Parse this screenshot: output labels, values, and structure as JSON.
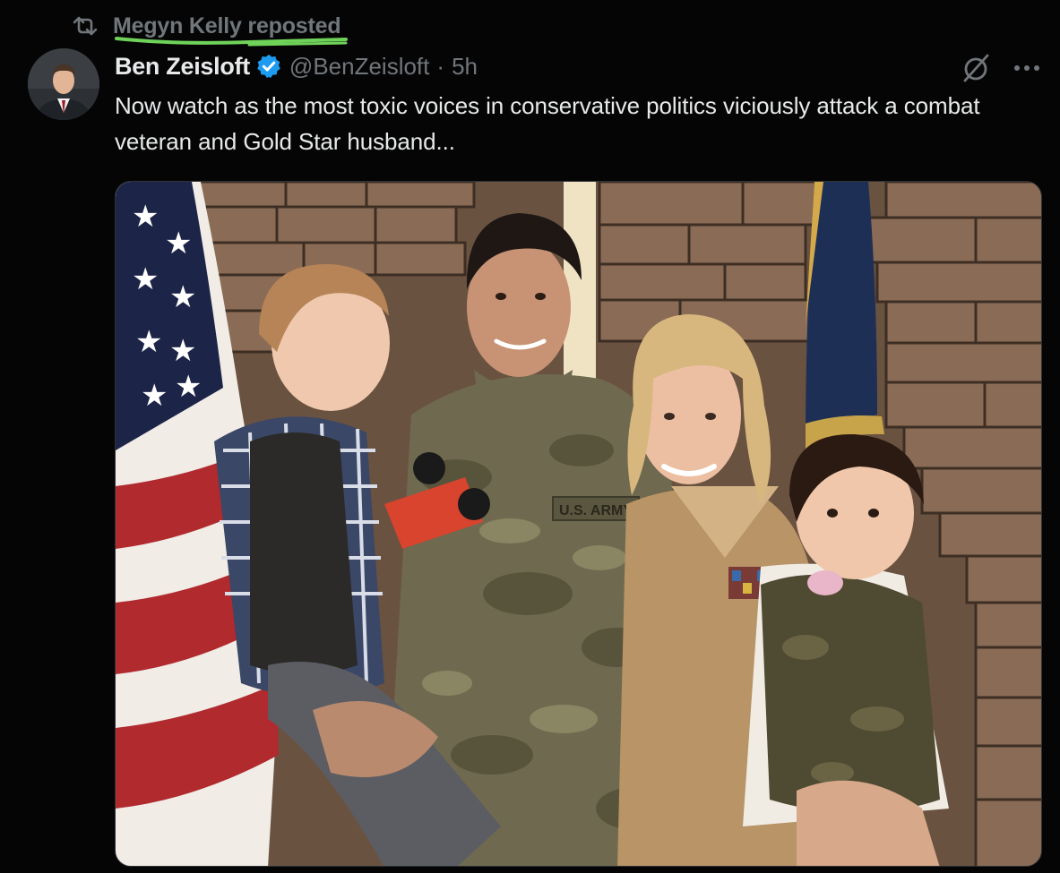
{
  "repost": {
    "label": "Megyn Kelly reposted",
    "icon": "repost-icon",
    "highlight_color": "#6fd35a"
  },
  "author": {
    "display_name": "Ben Zeisloft",
    "handle": "@BenZeisloft",
    "separator": "·",
    "time": "5h",
    "verified_color": "#1d9bf0"
  },
  "tweet": {
    "text": "Now watch as the most toxic voices in conservative politics viciously attack a combat veteran and Gold Star husband..."
  },
  "actions": {
    "grok_icon": "grok-icon",
    "more_icon": "more-icon"
  },
  "media": {
    "type": "photo",
    "patch_text": "U.S. ARMY"
  }
}
